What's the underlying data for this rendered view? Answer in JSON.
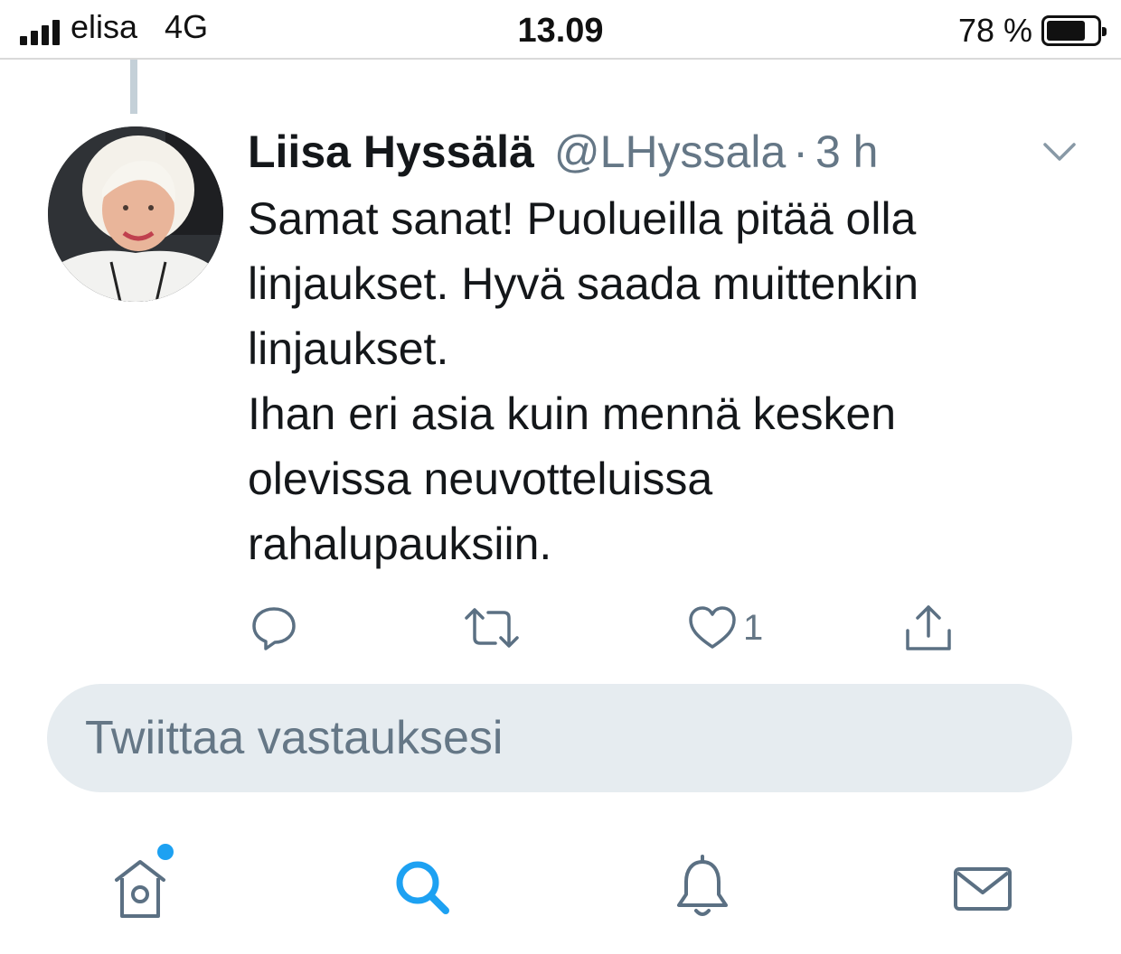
{
  "status_bar": {
    "carrier": "elisa",
    "network": "4G",
    "time": "13.09",
    "battery_percent_label": "78 %",
    "battery_level": 0.78,
    "signal_bars": 4
  },
  "tweet": {
    "author_name": "Liisa Hyssälä",
    "handle": "@LHyssala",
    "separator": "·",
    "time_ago": "3 h",
    "text_lines": [
      "Samat sanat! Puolueilla pitää olla",
      "linjaukset. Hyvä saada muittenkin",
      "linjaukset.",
      "Ihan eri asia kuin mennä kesken",
      "olevissa neuvotteluissa",
      "rahalupauksiin."
    ],
    "actions": {
      "reply_icon": "reply-icon",
      "retweet_icon": "retweet-icon",
      "like_icon": "heart-icon",
      "like_count": "1",
      "share_icon": "share-icon"
    }
  },
  "reply_box": {
    "placeholder": "Twiittaa vastauksesi"
  },
  "tab_bar": {
    "tabs": [
      {
        "name": "home",
        "icon": "home-icon",
        "has_notification": true
      },
      {
        "name": "search",
        "icon": "search-icon",
        "active": true
      },
      {
        "name": "notifications",
        "icon": "bell-icon"
      },
      {
        "name": "messages",
        "icon": "mail-icon"
      }
    ]
  },
  "colors": {
    "accent": "#1da1f2",
    "secondary_text": "#657786",
    "icon_gray": "#5b7083",
    "reply_box_bg": "#e6ecf0"
  }
}
